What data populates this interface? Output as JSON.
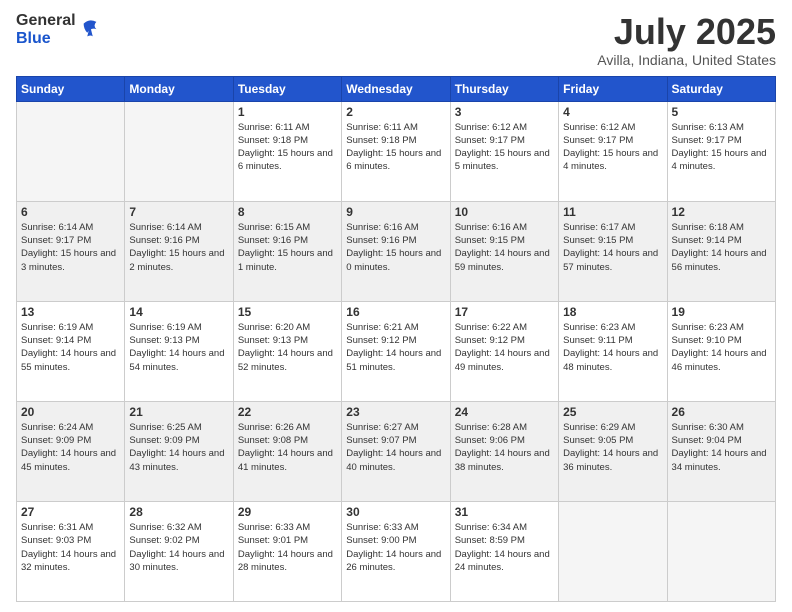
{
  "logo": {
    "general": "General",
    "blue": "Blue"
  },
  "title": "July 2025",
  "location": "Avilla, Indiana, United States",
  "days_of_week": [
    "Sunday",
    "Monday",
    "Tuesday",
    "Wednesday",
    "Thursday",
    "Friday",
    "Saturday"
  ],
  "weeks": [
    [
      {
        "day": "",
        "empty": true
      },
      {
        "day": "",
        "empty": true
      },
      {
        "day": "1",
        "sunrise": "Sunrise: 6:11 AM",
        "sunset": "Sunset: 9:18 PM",
        "daylight": "Daylight: 15 hours and 6 minutes."
      },
      {
        "day": "2",
        "sunrise": "Sunrise: 6:11 AM",
        "sunset": "Sunset: 9:18 PM",
        "daylight": "Daylight: 15 hours and 6 minutes."
      },
      {
        "day": "3",
        "sunrise": "Sunrise: 6:12 AM",
        "sunset": "Sunset: 9:17 PM",
        "daylight": "Daylight: 15 hours and 5 minutes."
      },
      {
        "day": "4",
        "sunrise": "Sunrise: 6:12 AM",
        "sunset": "Sunset: 9:17 PM",
        "daylight": "Daylight: 15 hours and 4 minutes."
      },
      {
        "day": "5",
        "sunrise": "Sunrise: 6:13 AM",
        "sunset": "Sunset: 9:17 PM",
        "daylight": "Daylight: 15 hours and 4 minutes."
      }
    ],
    [
      {
        "day": "6",
        "sunrise": "Sunrise: 6:14 AM",
        "sunset": "Sunset: 9:17 PM",
        "daylight": "Daylight: 15 hours and 3 minutes."
      },
      {
        "day": "7",
        "sunrise": "Sunrise: 6:14 AM",
        "sunset": "Sunset: 9:16 PM",
        "daylight": "Daylight: 15 hours and 2 minutes."
      },
      {
        "day": "8",
        "sunrise": "Sunrise: 6:15 AM",
        "sunset": "Sunset: 9:16 PM",
        "daylight": "Daylight: 15 hours and 1 minute."
      },
      {
        "day": "9",
        "sunrise": "Sunrise: 6:16 AM",
        "sunset": "Sunset: 9:16 PM",
        "daylight": "Daylight: 15 hours and 0 minutes."
      },
      {
        "day": "10",
        "sunrise": "Sunrise: 6:16 AM",
        "sunset": "Sunset: 9:15 PM",
        "daylight": "Daylight: 14 hours and 59 minutes."
      },
      {
        "day": "11",
        "sunrise": "Sunrise: 6:17 AM",
        "sunset": "Sunset: 9:15 PM",
        "daylight": "Daylight: 14 hours and 57 minutes."
      },
      {
        "day": "12",
        "sunrise": "Sunrise: 6:18 AM",
        "sunset": "Sunset: 9:14 PM",
        "daylight": "Daylight: 14 hours and 56 minutes."
      }
    ],
    [
      {
        "day": "13",
        "sunrise": "Sunrise: 6:19 AM",
        "sunset": "Sunset: 9:14 PM",
        "daylight": "Daylight: 14 hours and 55 minutes."
      },
      {
        "day": "14",
        "sunrise": "Sunrise: 6:19 AM",
        "sunset": "Sunset: 9:13 PM",
        "daylight": "Daylight: 14 hours and 54 minutes."
      },
      {
        "day": "15",
        "sunrise": "Sunrise: 6:20 AM",
        "sunset": "Sunset: 9:13 PM",
        "daylight": "Daylight: 14 hours and 52 minutes."
      },
      {
        "day": "16",
        "sunrise": "Sunrise: 6:21 AM",
        "sunset": "Sunset: 9:12 PM",
        "daylight": "Daylight: 14 hours and 51 minutes."
      },
      {
        "day": "17",
        "sunrise": "Sunrise: 6:22 AM",
        "sunset": "Sunset: 9:12 PM",
        "daylight": "Daylight: 14 hours and 49 minutes."
      },
      {
        "day": "18",
        "sunrise": "Sunrise: 6:23 AM",
        "sunset": "Sunset: 9:11 PM",
        "daylight": "Daylight: 14 hours and 48 minutes."
      },
      {
        "day": "19",
        "sunrise": "Sunrise: 6:23 AM",
        "sunset": "Sunset: 9:10 PM",
        "daylight": "Daylight: 14 hours and 46 minutes."
      }
    ],
    [
      {
        "day": "20",
        "sunrise": "Sunrise: 6:24 AM",
        "sunset": "Sunset: 9:09 PM",
        "daylight": "Daylight: 14 hours and 45 minutes."
      },
      {
        "day": "21",
        "sunrise": "Sunrise: 6:25 AM",
        "sunset": "Sunset: 9:09 PM",
        "daylight": "Daylight: 14 hours and 43 minutes."
      },
      {
        "day": "22",
        "sunrise": "Sunrise: 6:26 AM",
        "sunset": "Sunset: 9:08 PM",
        "daylight": "Daylight: 14 hours and 41 minutes."
      },
      {
        "day": "23",
        "sunrise": "Sunrise: 6:27 AM",
        "sunset": "Sunset: 9:07 PM",
        "daylight": "Daylight: 14 hours and 40 minutes."
      },
      {
        "day": "24",
        "sunrise": "Sunrise: 6:28 AM",
        "sunset": "Sunset: 9:06 PM",
        "daylight": "Daylight: 14 hours and 38 minutes."
      },
      {
        "day": "25",
        "sunrise": "Sunrise: 6:29 AM",
        "sunset": "Sunset: 9:05 PM",
        "daylight": "Daylight: 14 hours and 36 minutes."
      },
      {
        "day": "26",
        "sunrise": "Sunrise: 6:30 AM",
        "sunset": "Sunset: 9:04 PM",
        "daylight": "Daylight: 14 hours and 34 minutes."
      }
    ],
    [
      {
        "day": "27",
        "sunrise": "Sunrise: 6:31 AM",
        "sunset": "Sunset: 9:03 PM",
        "daylight": "Daylight: 14 hours and 32 minutes."
      },
      {
        "day": "28",
        "sunrise": "Sunrise: 6:32 AM",
        "sunset": "Sunset: 9:02 PM",
        "daylight": "Daylight: 14 hours and 30 minutes."
      },
      {
        "day": "29",
        "sunrise": "Sunrise: 6:33 AM",
        "sunset": "Sunset: 9:01 PM",
        "daylight": "Daylight: 14 hours and 28 minutes."
      },
      {
        "day": "30",
        "sunrise": "Sunrise: 6:33 AM",
        "sunset": "Sunset: 9:00 PM",
        "daylight": "Daylight: 14 hours and 26 minutes."
      },
      {
        "day": "31",
        "sunrise": "Sunrise: 6:34 AM",
        "sunset": "Sunset: 8:59 PM",
        "daylight": "Daylight: 14 hours and 24 minutes."
      },
      {
        "day": "",
        "empty": true
      },
      {
        "day": "",
        "empty": true
      }
    ]
  ]
}
